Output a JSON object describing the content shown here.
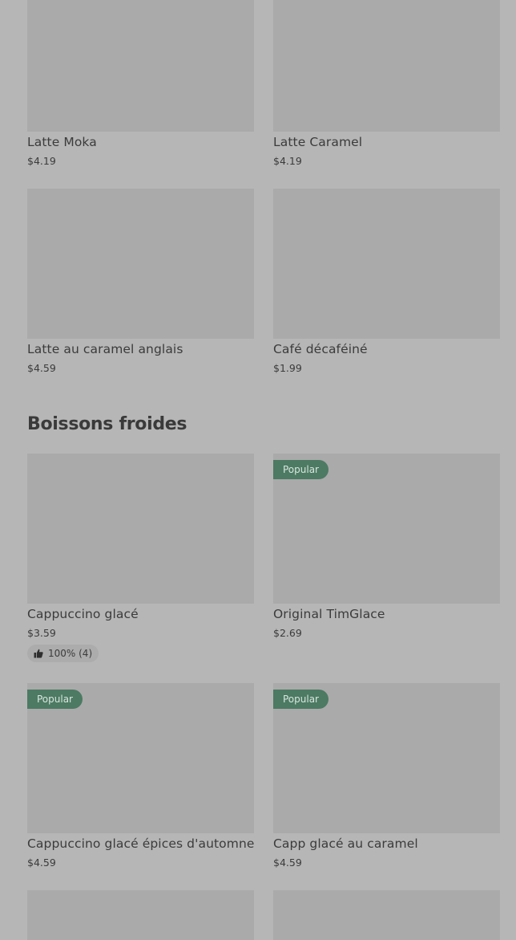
{
  "section_hot": {
    "items": [
      {
        "name": "Latte Moka",
        "price": "$4.19"
      },
      {
        "name": "Latte Caramel",
        "price": "$4.19"
      },
      {
        "name": "Latte au caramel anglais",
        "price": "$4.59"
      },
      {
        "name": "Café décaféiné",
        "price": "$1.99"
      }
    ]
  },
  "section_cold": {
    "title": "Boissons froides",
    "items": [
      {
        "name": "Cappuccino glacé",
        "price": "$3.59",
        "rating": "100% (4)"
      },
      {
        "name": "Original TimGlace",
        "price": "$2.69",
        "badge": "Popular"
      },
      {
        "name": "Cappuccino glacé épices d'automne",
        "price": "$4.59",
        "badge": "Popular"
      },
      {
        "name": "Capp glacé au caramel",
        "price": "$4.59",
        "badge": "Popular"
      }
    ]
  },
  "colors": {
    "background": "#b6b6b6",
    "image_placeholder": "#aaaaaa",
    "badge_bg": "#4c7a63",
    "text": "#3b3b3b"
  },
  "icons": {
    "rating": "thumbs-up-icon"
  }
}
